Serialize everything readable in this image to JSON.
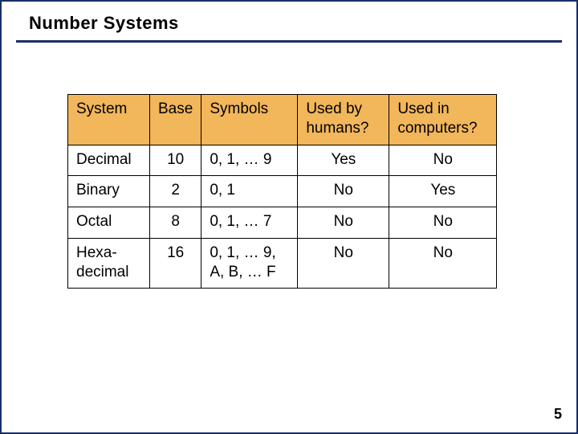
{
  "title": "Number Systems",
  "headers": {
    "system": "System",
    "base": "Base",
    "symbols": "Symbols",
    "humans": "Used by humans?",
    "computers": "Used in computers?"
  },
  "rows": [
    {
      "system": "Decimal",
      "base": "10",
      "symbols": "0, 1, … 9",
      "humans": "Yes",
      "computers": "No"
    },
    {
      "system": "Binary",
      "base": "2",
      "symbols": "0, 1",
      "humans": "No",
      "computers": "Yes"
    },
    {
      "system": "Octal",
      "base": "8",
      "symbols": "0, 1, … 7",
      "humans": "No",
      "computers": "No"
    },
    {
      "system": "Hexa-decimal",
      "base": "16",
      "symbols": "0, 1, … 9, A, B, … F",
      "humans": "No",
      "computers": "No"
    }
  ],
  "page_number": "5",
  "chart_data": {
    "type": "table",
    "title": "Number Systems",
    "columns": [
      "System",
      "Base",
      "Symbols",
      "Used by humans?",
      "Used in computers?"
    ],
    "data": [
      [
        "Decimal",
        10,
        "0, 1, … 9",
        "Yes",
        "No"
      ],
      [
        "Binary",
        2,
        "0, 1",
        "No",
        "Yes"
      ],
      [
        "Octal",
        8,
        "0, 1, … 7",
        "No",
        "No"
      ],
      [
        "Hexadecimal",
        16,
        "0, 1, … 9, A, B, … F",
        "No",
        "No"
      ]
    ]
  }
}
